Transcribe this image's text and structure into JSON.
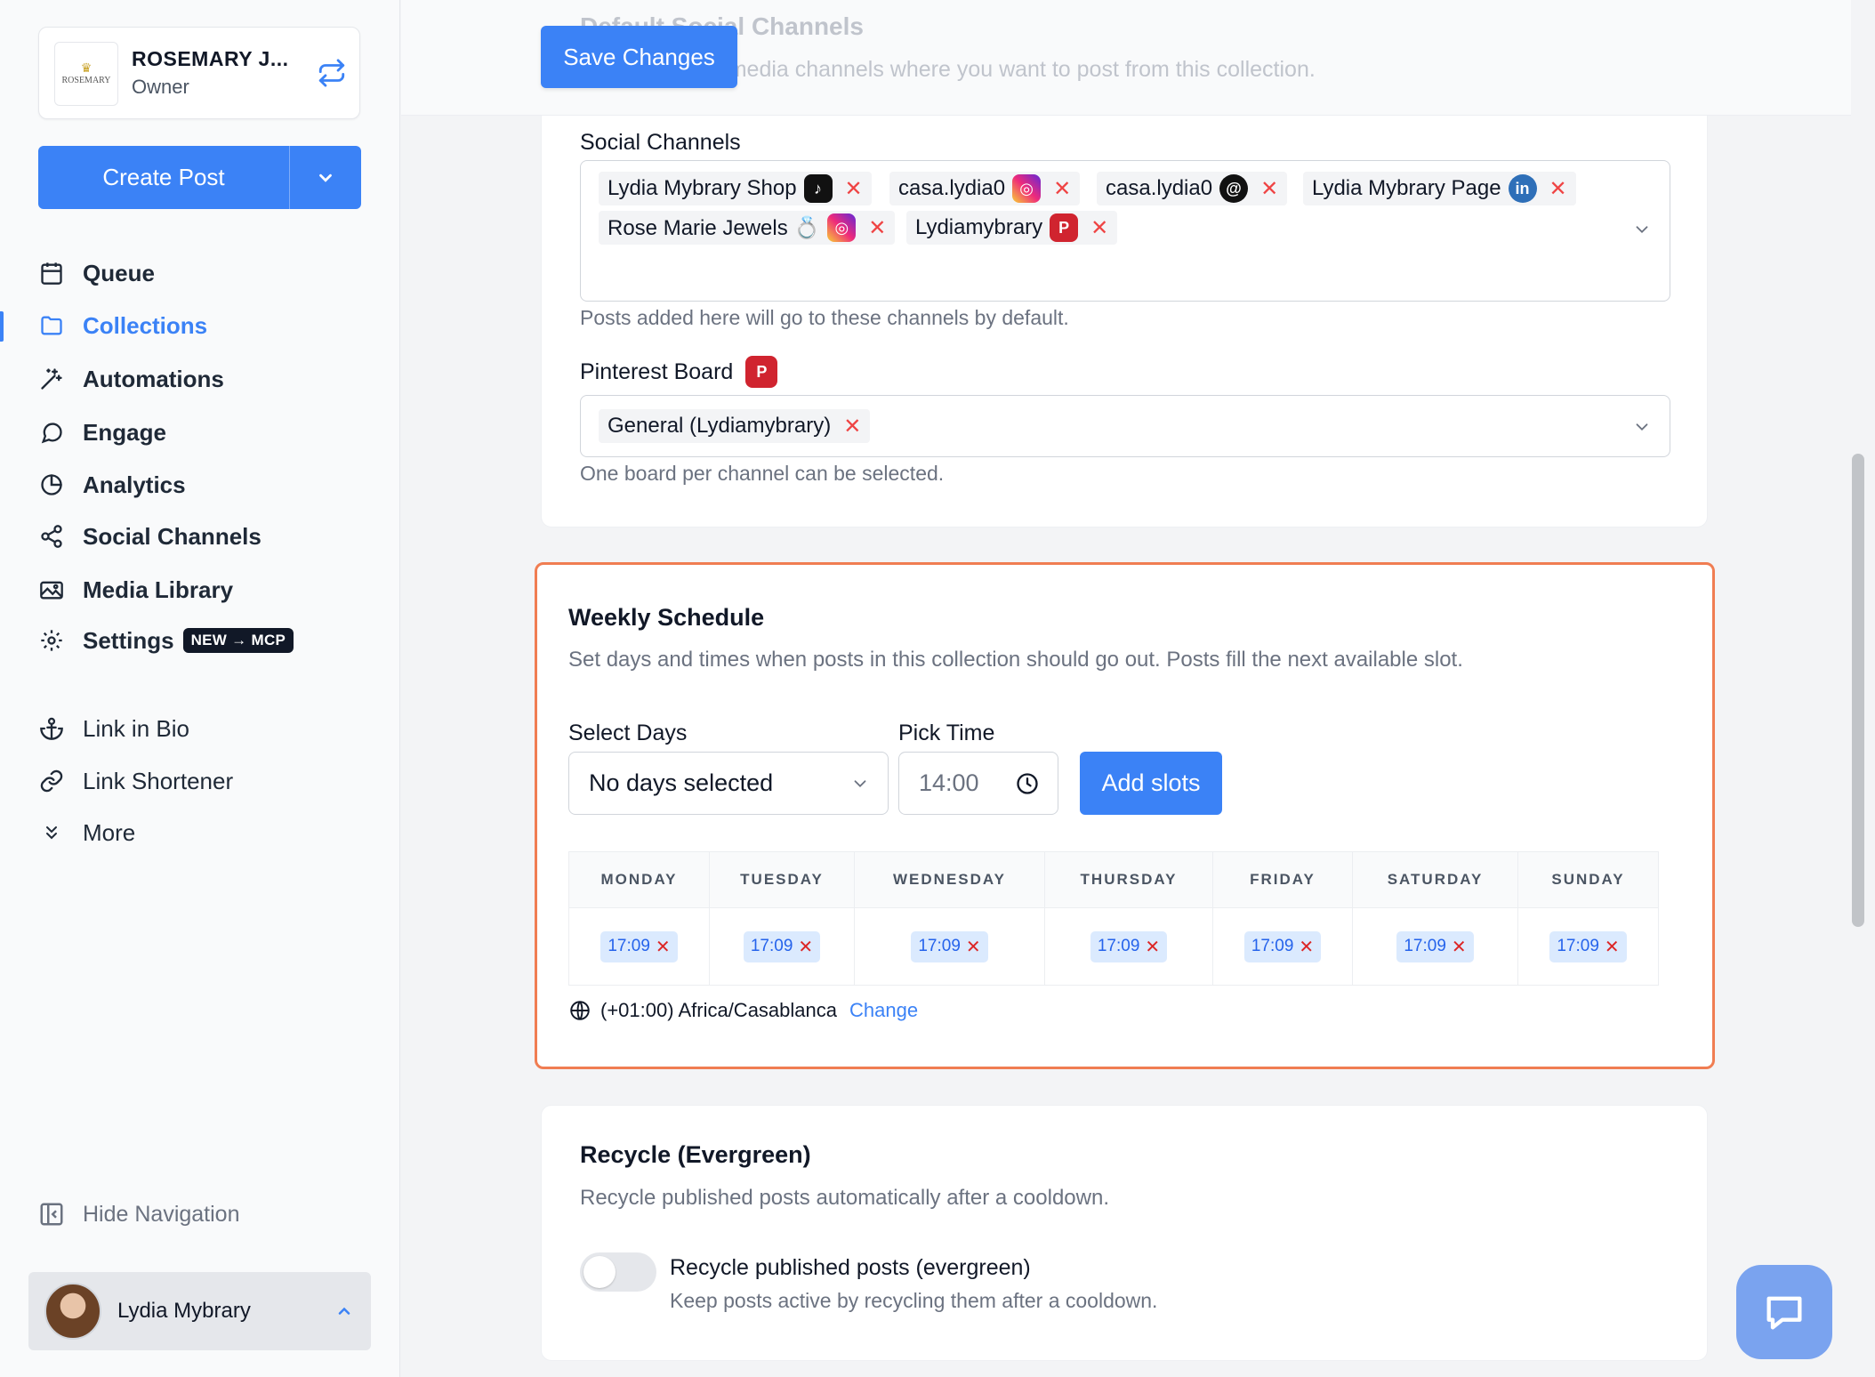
{
  "org": {
    "name": "ROSEMARY J...",
    "role": "Owner",
    "logo_text": "ROSEMARY"
  },
  "sidebar": {
    "create_post": "Create Post",
    "items": [
      {
        "label": "Queue",
        "icon": "calendar-icon"
      },
      {
        "label": "Collections",
        "icon": "folder-icon",
        "active": true
      },
      {
        "label": "Automations",
        "icon": "magic-wand-icon"
      },
      {
        "label": "Engage",
        "icon": "chat-bubble-icon"
      },
      {
        "label": "Analytics",
        "icon": "pie-chart-icon"
      },
      {
        "label": "Social Channels",
        "icon": "share-icon"
      },
      {
        "label": "Media Library",
        "icon": "images-icon"
      },
      {
        "label": "Settings",
        "icon": "gear-icon",
        "badge": "NEW → MCP"
      }
    ],
    "secondary": [
      {
        "label": "Link in Bio",
        "icon": "anchor-icon"
      },
      {
        "label": "Link Shortener",
        "icon": "link-icon"
      },
      {
        "label": "More",
        "icon": "chevrons-down-icon"
      }
    ],
    "hide_nav": "Hide Navigation",
    "user": "Lydia Mybrary"
  },
  "header": {
    "save": "Save Changes",
    "faded_title": "Default Social Channels",
    "faded_desc": "Pick the social media channels where you want to post from this collection."
  },
  "channels": {
    "label": "Social Channels",
    "chips": [
      {
        "name": "Lydia Mybrary Shop",
        "icon": "tiktok-icon"
      },
      {
        "name": "casa.lydia0",
        "icon": "instagram-icon"
      },
      {
        "name": "casa.lydia0",
        "icon": "threads-icon"
      },
      {
        "name": "Lydia Mybrary Page",
        "icon": "linkedin-icon"
      },
      {
        "name": "Rose Marie Jewels 💍",
        "icon": "instagram-icon"
      },
      {
        "name": "Lydiamybrary",
        "icon": "pinterest-icon"
      }
    ],
    "help": "Posts added here will go to these channels by default.",
    "board_label": "Pinterest Board",
    "board": "General (Lydiamybrary)",
    "board_help": "One board per channel can be selected."
  },
  "weekly": {
    "title": "Weekly Schedule",
    "desc": "Set days and times when posts in this collection should go out. Posts fill the next available slot.",
    "days_label": "Select Days",
    "days_value": "No days selected",
    "time_label": "Pick Time",
    "time_value": "14:00",
    "add": "Add slots",
    "days": [
      "MONDAY",
      "TUESDAY",
      "WEDNESDAY",
      "THURSDAY",
      "FRIDAY",
      "SATURDAY",
      "SUNDAY"
    ],
    "slots": [
      "17:09",
      "17:09",
      "17:09",
      "17:09",
      "17:09",
      "17:09",
      "17:09"
    ],
    "timezone": "(+01:00) Africa/Casablanca",
    "change": "Change"
  },
  "recycle": {
    "title": "Recycle (Evergreen)",
    "desc": "Recycle published posts automatically after a cooldown.",
    "toggle_label": "Recycle published posts (evergreen)",
    "toggle_help": "Keep posts active by recycling them after a cooldown.",
    "enabled": false
  },
  "colors": {
    "accent": "#3b82f6",
    "highlight_border": "#f07d52",
    "remove": "#ef4444"
  }
}
